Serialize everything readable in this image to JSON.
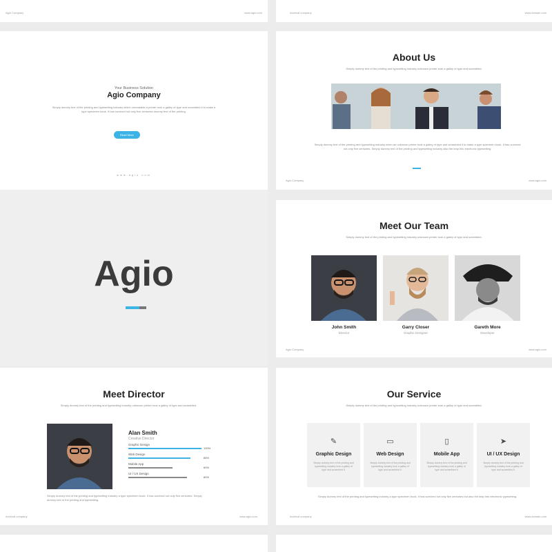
{
  "theme": {
    "accent": "#3bb4e5",
    "background": "#ececec",
    "slide": "#ffffff"
  },
  "top_row": {
    "left_footer": "Agio Company",
    "left_url": "www.agio.com",
    "right_footer": "Archival company",
    "right_url": "www.domain.com"
  },
  "slide_intro": {
    "kicker": "Your Business Solution",
    "title": "Agio Company",
    "body": "Simply dummy text of the printing and typesetting industry which unreadable a printer took a galley of type and scrambled it to make a type specimen book. It has survived not only five centuries dummy text of the printing.",
    "button": "Read More",
    "url": "www.agio.com"
  },
  "slide_about": {
    "title": "About Us",
    "subtitle": "Simply dummy text of the printing and typesetting industry unknown printer took a galley of type and scrambled.",
    "body": "Simply dummy text of the printing and typesetting industry when an unknown printer took a galley of type and scrambled it to make a type specimen book. It has survived not only five centuries. Simply dummy text of the printing and typesetting industry also the leap into electronic typesetting.",
    "footer_left": "Agio Company",
    "footer_right": "www.agio.com"
  },
  "slide_cover": {
    "title": "Agio"
  },
  "slide_team": {
    "title": "Meet Our Team",
    "subtitle": "Simply dummy text of the printing and typesetting industry unknown printer took a galley of type and scrambled.",
    "members": [
      {
        "name": "John Smith",
        "role": "Director"
      },
      {
        "name": "Garry Closer",
        "role": "Graphic Designer"
      },
      {
        "name": "Gareth More",
        "role": "Developer"
      }
    ],
    "footer_left": "Agio Company",
    "footer_right": "www.agio.com"
  },
  "slide_director": {
    "title": "Meet Director",
    "subtitle": "Simply dummy text of the printing and typesetting industry unknown printer took a galley of type and scrambled.",
    "name": "Alan Smith",
    "role": "Creative Director",
    "skills": [
      {
        "label": "Graphic Design",
        "value": 100,
        "pct": "100%"
      },
      {
        "label": "Web Design",
        "value": 85,
        "pct": "85%"
      },
      {
        "label": "Mobile App",
        "value": 60,
        "pct": "60%"
      },
      {
        "label": "UI / UX Design",
        "value": 80,
        "pct": "80%"
      }
    ],
    "body": "Simply dummy text of the printing and typesetting industry a type specimen book. It has survived not only five centuries. Simply dummy text of the printing and typesetting.",
    "footer_left": "Archival company",
    "footer_right": "www.agio.com"
  },
  "slide_service": {
    "title": "Our Service",
    "subtitle": "Simply dummy text of the printing and typesetting industry unknown printer took a galley of type and scrambled.",
    "services": [
      {
        "name": "Graphic Design",
        "icon": "edit-icon",
        "glyph": "✎"
      },
      {
        "name": "Web Design",
        "icon": "monitor-icon",
        "glyph": "▭"
      },
      {
        "name": "Mobile App",
        "icon": "phone-icon",
        "glyph": "▯"
      },
      {
        "name": "UI / UX Design",
        "icon": "paper-plane-icon",
        "glyph": "➤"
      }
    ],
    "card_text": "Simply dummy text of the printing and typesetting industry took a galley of type and scrambled it.",
    "body": "Simply dummy text of the printing and typesetting industry a type specimen book. It has survived not only five centuries but also the leap into electronic typesetting.",
    "footer_left": "Archival company",
    "footer_right": "www.domain.com"
  }
}
